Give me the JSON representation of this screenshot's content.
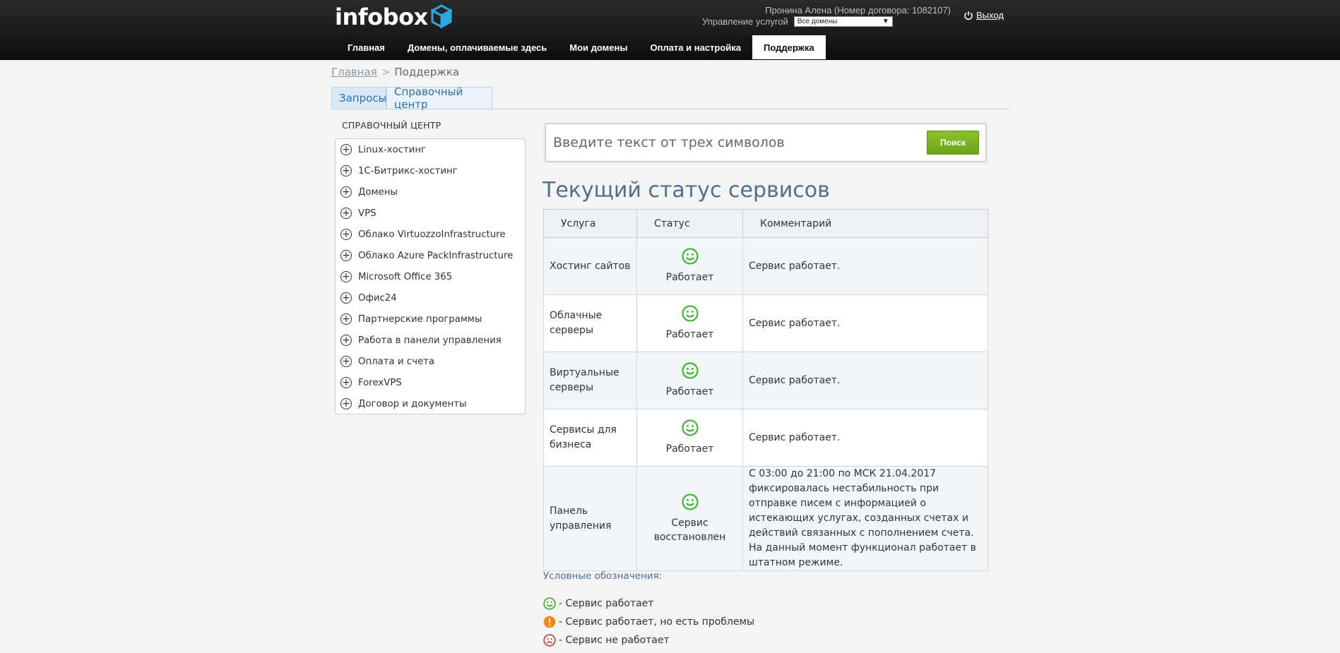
{
  "header": {
    "logo_text": "infobox",
    "user_text": "Пронина Алена (Номер договора: 1082107)",
    "services_label": "Управление услугой",
    "services_select_value": "Все домены",
    "logout_label": "Выход"
  },
  "nav": {
    "items": [
      {
        "label": "Главная"
      },
      {
        "label": "Домены, оплачиваемые здесь"
      },
      {
        "label": "Мои домены"
      },
      {
        "label": "Оплата и настройка"
      },
      {
        "label": "Поддержка"
      }
    ]
  },
  "breadcrumb": {
    "home": "Главная",
    "separator": ">",
    "current": "Поддержка"
  },
  "tabs": [
    {
      "label": "Запросы"
    },
    {
      "label": "Справочный центр"
    }
  ],
  "sidebar": {
    "title": "СПРАВОЧНЫЙ ЦЕНТР",
    "items": [
      {
        "label": "Linux-хостинг"
      },
      {
        "label": "1С-Битрикс-хостинг"
      },
      {
        "label": "Домены"
      },
      {
        "label": "VPS"
      },
      {
        "label": "Облако VirtuozzoInfrastructure"
      },
      {
        "label": "Облако Azure PackInfrastructure"
      },
      {
        "label": "Microsoft Office 365"
      },
      {
        "label": "Офис24"
      },
      {
        "label": "Партнерские программы"
      },
      {
        "label": "Работа в панели управления"
      },
      {
        "label": "Оплата и счета"
      },
      {
        "label": "ForexVPS"
      },
      {
        "label": "Договор и документы"
      }
    ]
  },
  "search": {
    "placeholder": "Введите текст от трех символов",
    "button": "Поиск"
  },
  "status": {
    "title": "Текущий статус сервисов",
    "headers": {
      "service": "Услуга",
      "status": "Статус",
      "comment": "Комментарий"
    },
    "rows": [
      {
        "service": "Хостинг сайтов",
        "status": "Работает",
        "comment": "Сервис работает."
      },
      {
        "service": "Облачные серверы",
        "status": "Работает",
        "comment": "Сервис работает."
      },
      {
        "service": "Виртуальные серверы",
        "status": "Работает",
        "comment": "Сервис работает."
      },
      {
        "service": "Сервисы для бизнеса",
        "status": "Работает",
        "comment": "Сервис работает."
      },
      {
        "service": "Панель управления",
        "status": "Сервис восстановлен",
        "comment": "С 03:00 до 21:00 по МСК 21.04.2017 фиксировалась нестабильность при отправке писем с информацией о истекающих услугах, созданных счетах и действий связанных с пополнением счета. На данный момент функционал работает в штатном режиме."
      }
    ]
  },
  "legend": {
    "title": "Условные обозначения:",
    "items": [
      {
        "icon": "smile-icon",
        "label": "- Сервис работает"
      },
      {
        "icon": "warning-icon",
        "label": "- Сервис работает, но есть проблемы"
      },
      {
        "icon": "sad-icon",
        "label": "- Сервис не работает"
      }
    ]
  },
  "colors": {
    "ok": "#2bb31e",
    "warning": "#f2880b",
    "error": "#c0392b",
    "accent": "#4e6f8f",
    "button": "#7ab320"
  }
}
